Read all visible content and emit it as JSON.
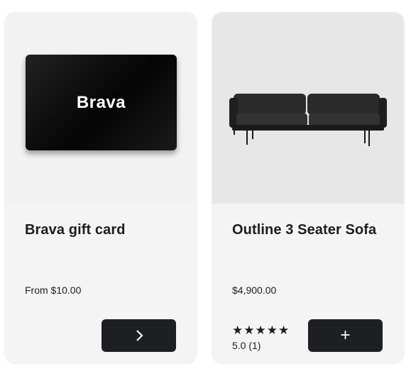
{
  "products": [
    {
      "title": "Brava gift card",
      "price": "From $10.00",
      "image_label": "Brava",
      "button_icon": "chevron-right-icon"
    },
    {
      "title": "Outline 3 Seater Sofa",
      "price": "$4,900.00",
      "stars": "★★★★★",
      "rating": "5.0 (1)",
      "button_label": "+",
      "button_icon": "plus-icon"
    }
  ],
  "colors": {
    "card_bg": "#f4f4f4",
    "button_bg": "#1d1f22",
    "text": "#1d1d1f"
  }
}
